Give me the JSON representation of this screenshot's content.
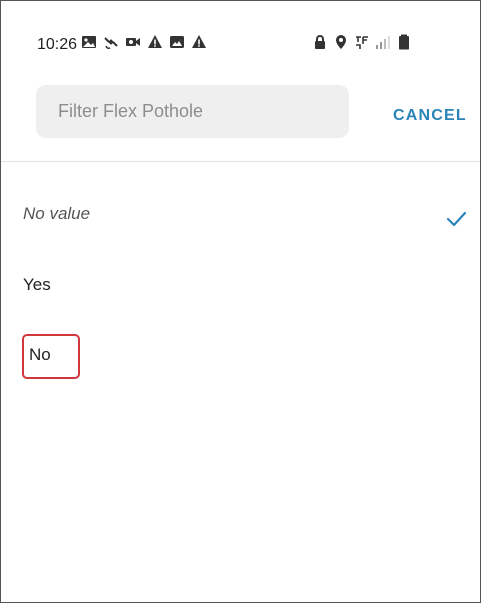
{
  "status_bar": {
    "time": "10:26",
    "notification_icons": [
      "gallery-icon",
      "satellite-icon",
      "meet-icon",
      "warning-icon",
      "image-icon",
      "warning-icon"
    ],
    "system_icons": [
      "lock-icon",
      "location-icon",
      "wifi-calling-icon",
      "signal-icon",
      "battery-icon"
    ]
  },
  "header": {
    "search_placeholder": "Filter Flex Pothole",
    "cancel_label": "CANCEL"
  },
  "options": [
    {
      "label": "No value",
      "selected": true
    },
    {
      "label": "Yes",
      "selected": false
    },
    {
      "label": "No",
      "selected": false,
      "highlighted": true
    }
  ],
  "colors": {
    "accent": "#2a84b8",
    "highlight": "#d0373d"
  }
}
